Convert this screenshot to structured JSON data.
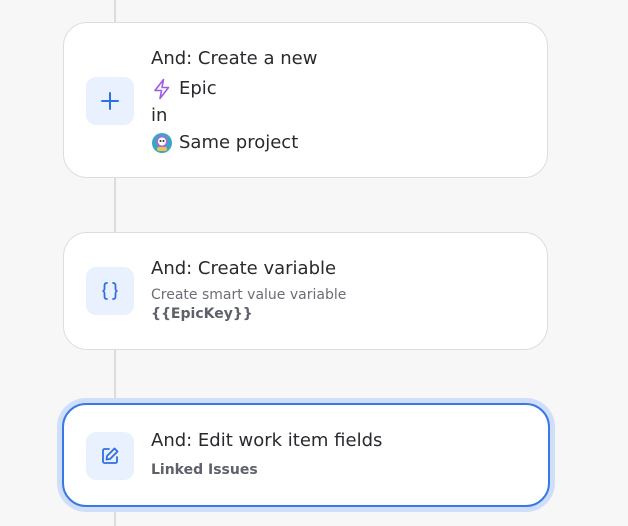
{
  "steps": [
    {
      "title": "And: Create a new",
      "item_type": "Epic",
      "connector": "in",
      "project": "Same project",
      "icon": "plus-icon"
    },
    {
      "title": "And: Create variable",
      "description": "Create smart value variable",
      "variable": "{{EpicKey}}",
      "icon": "braces-icon"
    },
    {
      "title": "And: Edit work item fields",
      "field": "Linked Issues",
      "icon": "edit-icon",
      "selected": true
    }
  ],
  "colors": {
    "accent": "#3b78e7",
    "icon_bg": "#e9f0fe",
    "epic": "#a05be6"
  }
}
